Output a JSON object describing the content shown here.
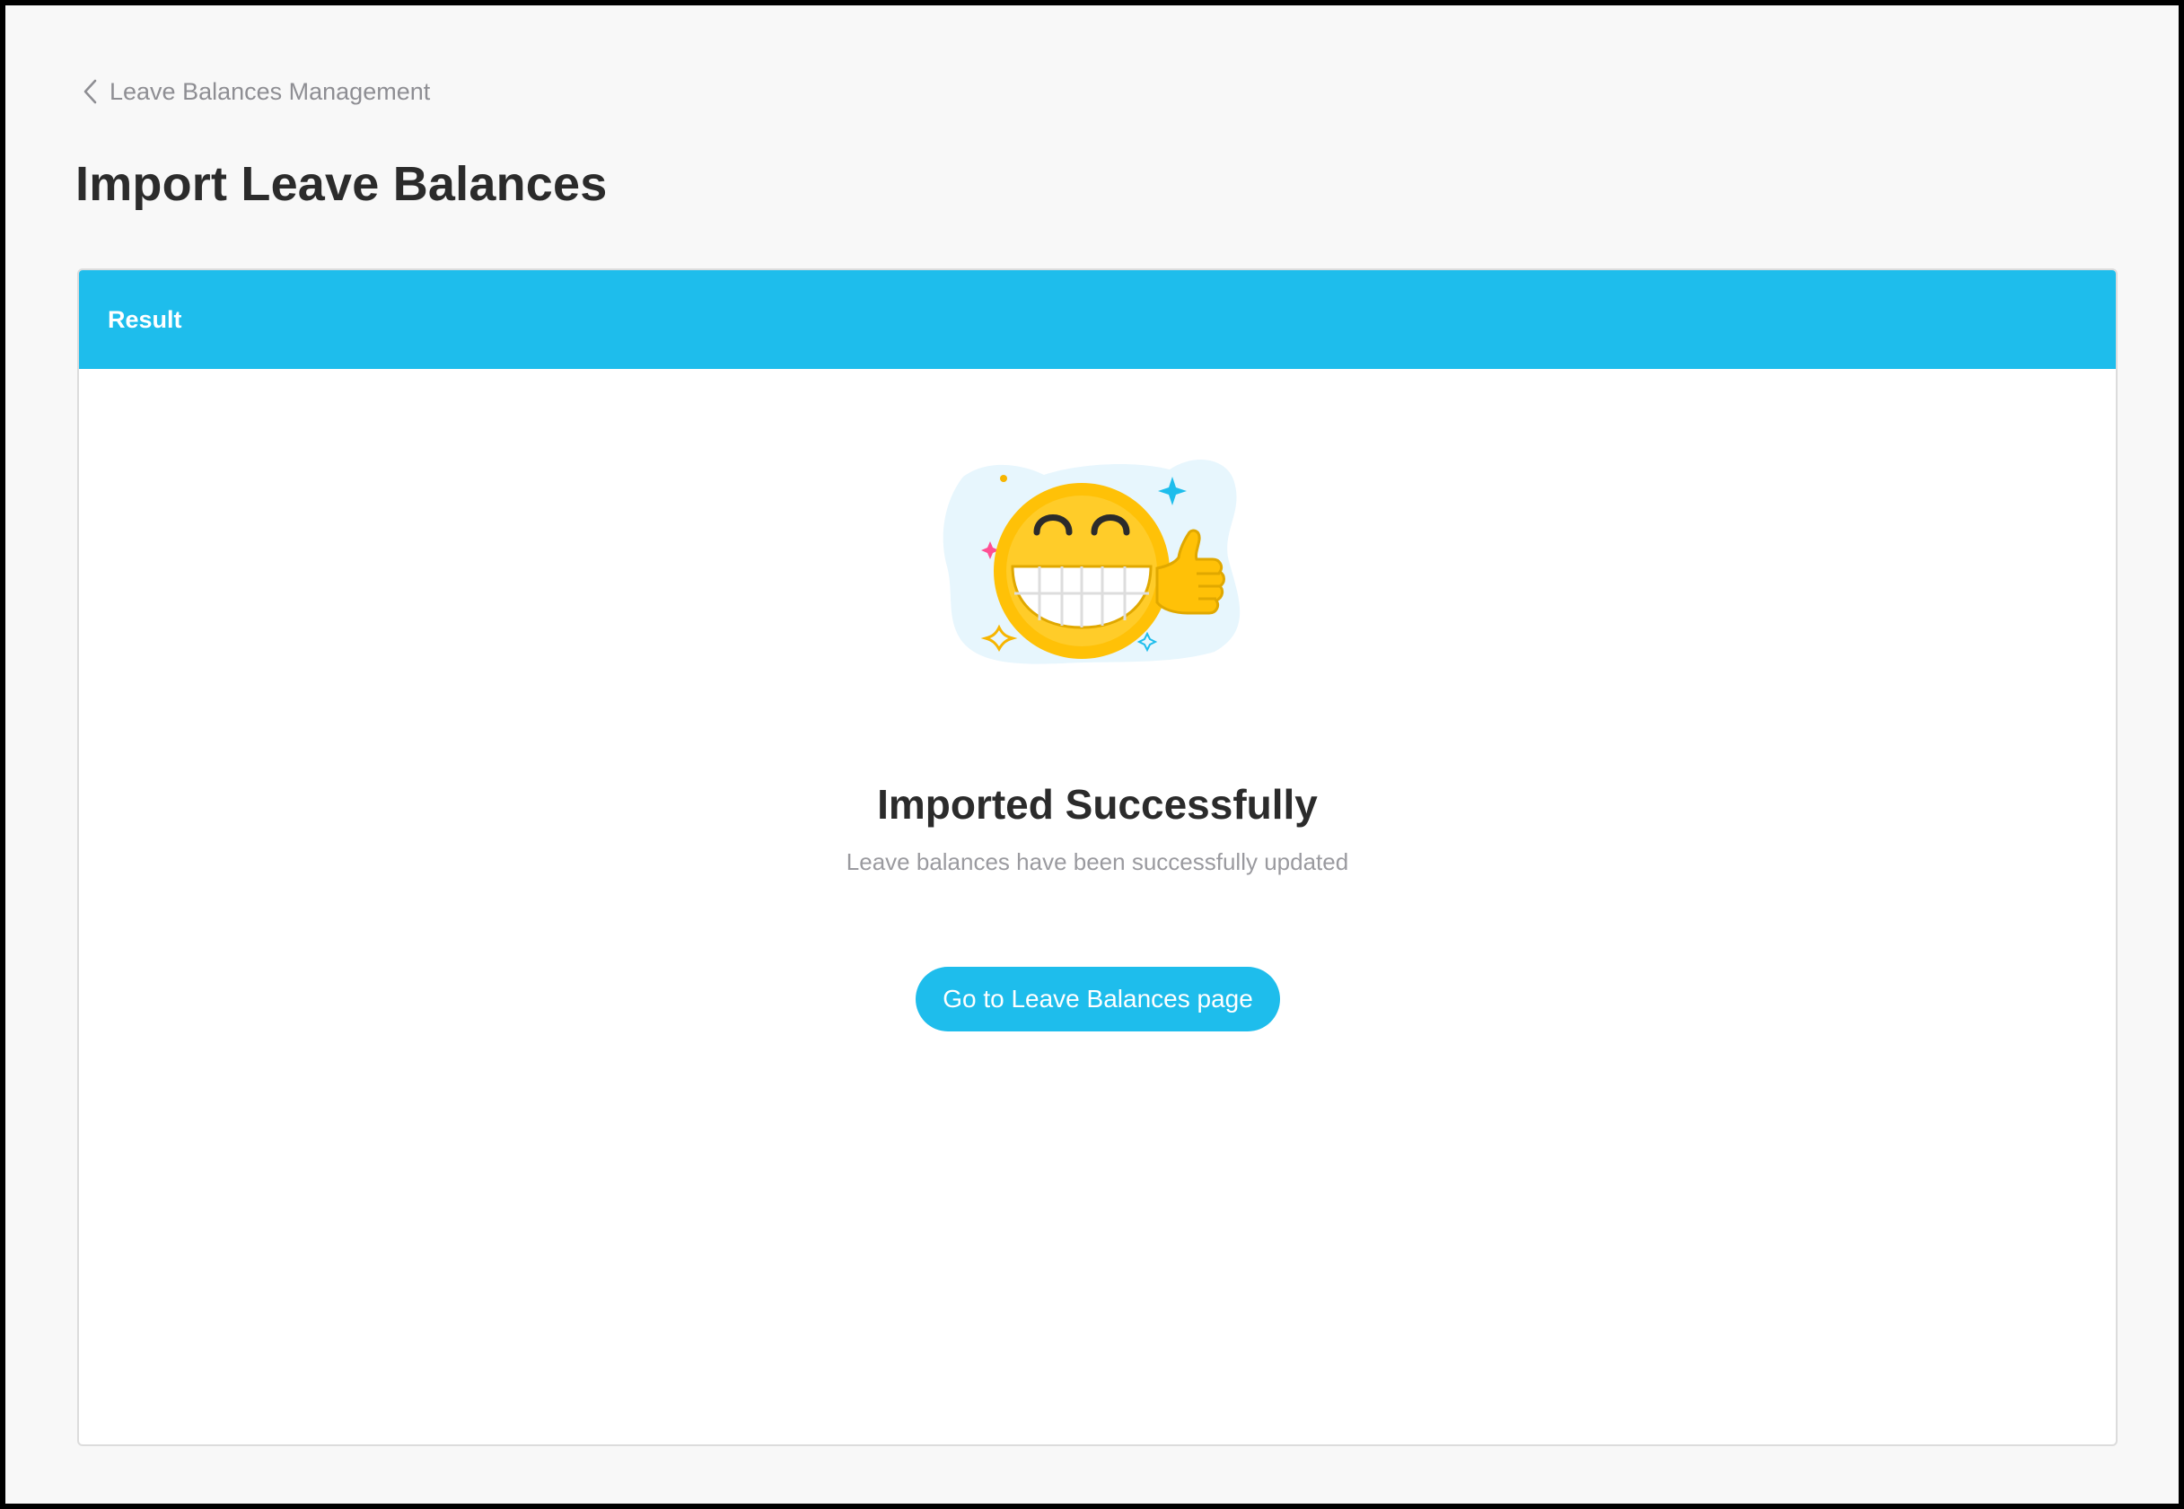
{
  "breadcrumb": {
    "back_label": "Leave Balances Management",
    "icon": "chevron-left-icon"
  },
  "page": {
    "title": "Import Leave Balances"
  },
  "result_card": {
    "header_title": "Result",
    "illustration": "grinning-thumbs-up-emoji",
    "heading": "Imported Successfully",
    "message": "Leave balances have been successfully updated",
    "button_label": "Go to Leave Balances page"
  },
  "colors": {
    "accent": "#1ebdec",
    "title_text": "#2b2b2b",
    "muted_text": "#8e8e93",
    "emoji_yellow": "#ffc107"
  }
}
